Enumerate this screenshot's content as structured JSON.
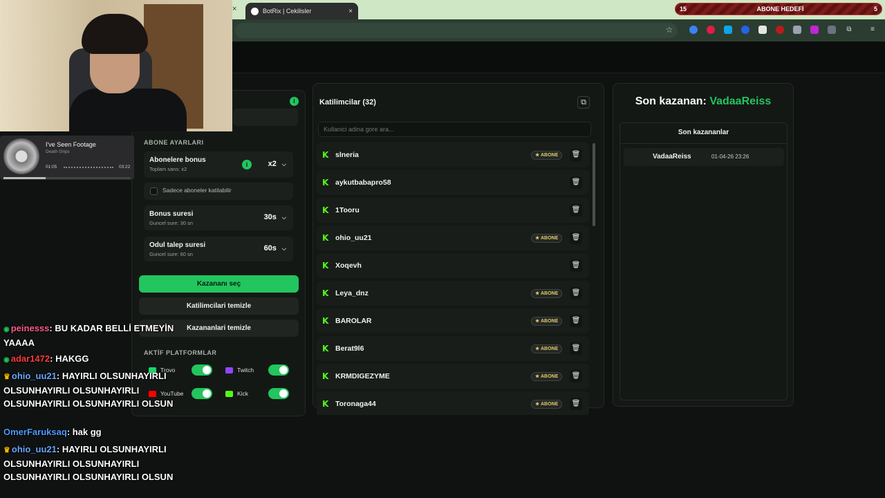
{
  "browser": {
    "tab_title": "BotRix | Cekilisler",
    "tab_close": "×",
    "prev_tab_close": "×"
  },
  "goal": {
    "left": "15",
    "label": "ABONE HEDEFİ",
    "right": "5"
  },
  "settings": {
    "section_title": "ABONE AYARLARI",
    "bonus_label": "Abonelere bonus",
    "bonus_sub": "Toplam sans: x2",
    "bonus_value": "x2",
    "only_subs_label": "Sadece aboneler katilabilir",
    "duration_label": "Bonus suresi",
    "duration_sub": "Guncel sure: 30 sn",
    "duration_value": "30s",
    "claim_label": "Odul talep suresi",
    "claim_sub": "Guncel sure: 60 sn",
    "claim_value": "60s",
    "pick_winner": "Kazananı seç",
    "clear_participants": "Katilimcilari temizle",
    "clear_winners": "Kazananlari temizle",
    "platforms_title": "AKTİF PLATFORMLAR",
    "platforms": [
      {
        "name": "Trovo",
        "icon": "trovo-icon",
        "color": "#19d66b",
        "enabled": true
      },
      {
        "name": "Twitch",
        "icon": "twitch-icon",
        "color": "#9146ff",
        "enabled": true
      },
      {
        "name": "YouTube",
        "icon": "youtube-icon",
        "color": "#ff0000",
        "enabled": true
      },
      {
        "name": "Kick",
        "icon": "kick-icon",
        "color": "#53fc18",
        "enabled": true
      }
    ]
  },
  "participants": {
    "title": "Katilimcilar (32)",
    "search_placeholder": "Kullanici adina gore ara...",
    "badge_label": "★ ABONE",
    "rows": [
      {
        "name": "slneria",
        "sub": true
      },
      {
        "name": "aykutbabapro58",
        "sub": false
      },
      {
        "name": "1Tooru",
        "sub": false
      },
      {
        "name": "ohio_uu21",
        "sub": true
      },
      {
        "name": "Xoqevh",
        "sub": false
      },
      {
        "name": "Leya_dnz",
        "sub": true
      },
      {
        "name": "BAROLAR",
        "sub": true
      },
      {
        "name": "Berat9l6",
        "sub": true
      },
      {
        "name": "KRMDIGEZYME",
        "sub": true
      },
      {
        "name": "Toronaga44",
        "sub": true
      }
    ]
  },
  "winners": {
    "head_prefix": "Son kazanan:",
    "head_name": "VadaaReiss",
    "list_title": "Son kazananlar",
    "rows": [
      {
        "name": "VadaaReiss",
        "date": "01-04-26 23:26"
      }
    ]
  },
  "music": {
    "title": "I've Seen Footage",
    "artist": "Death Grips",
    "elapsed": "01:05",
    "total": "03:22",
    "progress": 0.33
  },
  "chat": [
    {
      "user": "peinesss",
      "color": "#ff5a8a",
      "badge": "kick",
      "text": "BU KADAR BELLİ ETMEYİN YAAAA"
    },
    {
      "user": "adar1472",
      "color": "#ff3b3b",
      "badge": "kick",
      "text": "HAKGG"
    },
    {
      "user": "ohio_uu21",
      "color": "#6aa8ff",
      "badge": "crown",
      "text": "HAYIRLI OLSUNHAYIRLI OLSUNHAYIRLI OLSUNHAYIRLI OLSUNHAYIRLI OLSUNHAYIRLI OLSUN"
    },
    {
      "user": "OmerFaruksaq",
      "color": "#4f9bff",
      "badge": "",
      "text": "hak gg"
    },
    {
      "user": "ohio_uu21",
      "color": "#6aa8ff",
      "badge": "crown",
      "text": "HAYIRLI OLSUNHAYIRLI OLSUNHAYIRLI OLSUNHAYIRLI OLSUNHAYIRLI OLSUNHAYIRLI OLSUN"
    }
  ]
}
